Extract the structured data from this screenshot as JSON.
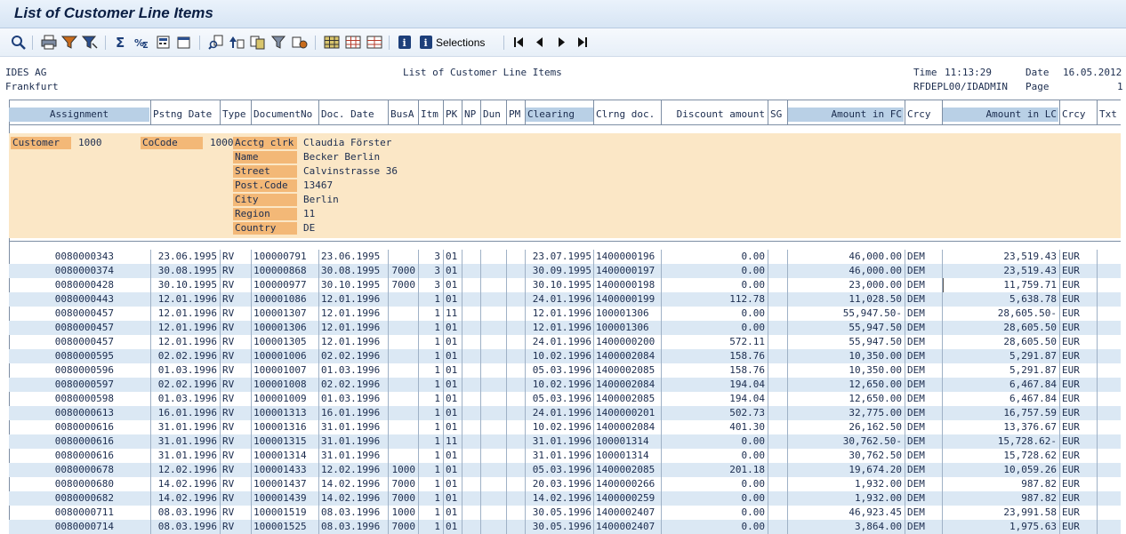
{
  "window": {
    "title": "List of Customer Line Items"
  },
  "toolbar": {
    "buttons": [
      "details-icon",
      "print-icon",
      "filter-icon",
      "filter-set-icon",
      "sum-icon",
      "subtotal-icon",
      "calculator-icon",
      "export-icon",
      "find-icon",
      "sort-ascending-icon",
      "sort-descending-icon",
      "layout-icon",
      "layout-save-icon",
      "grid-icon",
      "grid-change-icon",
      "grid-choose-icon",
      "info-icon",
      "selections-icon",
      "first-page-icon",
      "previous-page-icon",
      "next-page-icon",
      "last-page-icon"
    ],
    "selections_label": "Selections"
  },
  "report_header": {
    "company": "IDES AG",
    "city": "Frankfurt",
    "center_title": "List of Customer Line Items",
    "time_label": "Time",
    "time_value": "11:13:29",
    "date_label": "Date",
    "date_value": "16.05.2012",
    "program": "RFDEPL00/IDADMIN",
    "page_label": "Page",
    "page_value": "1"
  },
  "columns": [
    "Assignment",
    "Pstng Date",
    "Type",
    "DocumentNo",
    "Doc. Date",
    "BusA",
    "Itm",
    "PK",
    "NP",
    "Dun",
    "PM",
    "Clearing",
    "Clrng doc.",
    "Discount amount",
    "SG",
    "Amount in FC",
    "Crcy",
    "Amount in LC",
    "Crcy",
    "Txt"
  ],
  "customer": {
    "customer_label": "Customer",
    "customer_value": "1000",
    "cocode_label": "CoCode",
    "cocode_value": "1000",
    "fields": [
      {
        "label": "Acctg clrk",
        "value": "Claudia Förster"
      },
      {
        "label": "Name",
        "value": "Becker Berlin"
      },
      {
        "label": "Street",
        "value": "Calvinstrasse 36"
      },
      {
        "label": "Post.Code",
        "value": "13467"
      },
      {
        "label": "City",
        "value": "Berlin"
      },
      {
        "label": "Region",
        "value": "11"
      },
      {
        "label": "Country",
        "value": "DE"
      }
    ]
  },
  "rows": [
    {
      "assign": "0080000343",
      "pdate": "23.06.1995",
      "type": "RV",
      "doc": "100000791",
      "ddate": "23.06.1995",
      "busa": "",
      "itm": "3",
      "pk": "01",
      "clearing": "23.07.1995",
      "clrdoc": "1400000196",
      "disc": "0.00",
      "fc": "46,000.00",
      "fcc": "DEM",
      "lc": "23,519.43",
      "lcc": "EUR"
    },
    {
      "assign": "0080000374",
      "pdate": "30.08.1995",
      "type": "RV",
      "doc": "100000868",
      "ddate": "30.08.1995",
      "busa": "7000",
      "itm": "3",
      "pk": "01",
      "clearing": "30.09.1995",
      "clrdoc": "1400000197",
      "disc": "0.00",
      "fc": "46,000.00",
      "fcc": "DEM",
      "lc": "23,519.43",
      "lcc": "EUR"
    },
    {
      "assign": "0080000428",
      "pdate": "30.10.1995",
      "type": "RV",
      "doc": "100000977",
      "ddate": "30.10.1995",
      "busa": "7000",
      "itm": "3",
      "pk": "01",
      "clearing": "30.10.1995",
      "clrdoc": "1400000198",
      "disc": "0.00",
      "fc": "23,000.00",
      "fcc": "DEM",
      "lc": "11,759.71",
      "lcc": "EUR"
    },
    {
      "assign": "0080000443",
      "pdate": "12.01.1996",
      "type": "RV",
      "doc": "100001086",
      "ddate": "12.01.1996",
      "busa": "",
      "itm": "1",
      "pk": "01",
      "clearing": "24.01.1996",
      "clrdoc": "1400000199",
      "disc": "112.78",
      "fc": "11,028.50",
      "fcc": "DEM",
      "lc": "5,638.78",
      "lcc": "EUR"
    },
    {
      "assign": "0080000457",
      "pdate": "12.01.1996",
      "type": "RV",
      "doc": "100001307",
      "ddate": "12.01.1996",
      "busa": "",
      "itm": "1",
      "pk": "11",
      "clearing": "12.01.1996",
      "clrdoc": "100001306",
      "disc": "0.00",
      "fc": "55,947.50-",
      "fcc": "DEM",
      "lc": "28,605.50-",
      "lcc": "EUR"
    },
    {
      "assign": "0080000457",
      "pdate": "12.01.1996",
      "type": "RV",
      "doc": "100001306",
      "ddate": "12.01.1996",
      "busa": "",
      "itm": "1",
      "pk": "01",
      "clearing": "12.01.1996",
      "clrdoc": "100001306",
      "disc": "0.00",
      "fc": "55,947.50",
      "fcc": "DEM",
      "lc": "28,605.50",
      "lcc": "EUR"
    },
    {
      "assign": "0080000457",
      "pdate": "12.01.1996",
      "type": "RV",
      "doc": "100001305",
      "ddate": "12.01.1996",
      "busa": "",
      "itm": "1",
      "pk": "01",
      "clearing": "24.01.1996",
      "clrdoc": "1400000200",
      "disc": "572.11",
      "fc": "55,947.50",
      "fcc": "DEM",
      "lc": "28,605.50",
      "lcc": "EUR"
    },
    {
      "assign": "0080000595",
      "pdate": "02.02.1996",
      "type": "RV",
      "doc": "100001006",
      "ddate": "02.02.1996",
      "busa": "",
      "itm": "1",
      "pk": "01",
      "clearing": "10.02.1996",
      "clrdoc": "1400002084",
      "disc": "158.76",
      "fc": "10,350.00",
      "fcc": "DEM",
      "lc": "5,291.87",
      "lcc": "EUR"
    },
    {
      "assign": "0080000596",
      "pdate": "01.03.1996",
      "type": "RV",
      "doc": "100001007",
      "ddate": "01.03.1996",
      "busa": "",
      "itm": "1",
      "pk": "01",
      "clearing": "05.03.1996",
      "clrdoc": "1400002085",
      "disc": "158.76",
      "fc": "10,350.00",
      "fcc": "DEM",
      "lc": "5,291.87",
      "lcc": "EUR"
    },
    {
      "assign": "0080000597",
      "pdate": "02.02.1996",
      "type": "RV",
      "doc": "100001008",
      "ddate": "02.02.1996",
      "busa": "",
      "itm": "1",
      "pk": "01",
      "clearing": "10.02.1996",
      "clrdoc": "1400002084",
      "disc": "194.04",
      "fc": "12,650.00",
      "fcc": "DEM",
      "lc": "6,467.84",
      "lcc": "EUR"
    },
    {
      "assign": "0080000598",
      "pdate": "01.03.1996",
      "type": "RV",
      "doc": "100001009",
      "ddate": "01.03.1996",
      "busa": "",
      "itm": "1",
      "pk": "01",
      "clearing": "05.03.1996",
      "clrdoc": "1400002085",
      "disc": "194.04",
      "fc": "12,650.00",
      "fcc": "DEM",
      "lc": "6,467.84",
      "lcc": "EUR"
    },
    {
      "assign": "0080000613",
      "pdate": "16.01.1996",
      "type": "RV",
      "doc": "100001313",
      "ddate": "16.01.1996",
      "busa": "",
      "itm": "1",
      "pk": "01",
      "clearing": "24.01.1996",
      "clrdoc": "1400000201",
      "disc": "502.73",
      "fc": "32,775.00",
      "fcc": "DEM",
      "lc": "16,757.59",
      "lcc": "EUR"
    },
    {
      "assign": "0080000616",
      "pdate": "31.01.1996",
      "type": "RV",
      "doc": "100001316",
      "ddate": "31.01.1996",
      "busa": "",
      "itm": "1",
      "pk": "01",
      "clearing": "10.02.1996",
      "clrdoc": "1400002084",
      "disc": "401.30",
      "fc": "26,162.50",
      "fcc": "DEM",
      "lc": "13,376.67",
      "lcc": "EUR"
    },
    {
      "assign": "0080000616",
      "pdate": "31.01.1996",
      "type": "RV",
      "doc": "100001315",
      "ddate": "31.01.1996",
      "busa": "",
      "itm": "1",
      "pk": "11",
      "clearing": "31.01.1996",
      "clrdoc": "100001314",
      "disc": "0.00",
      "fc": "30,762.50-",
      "fcc": "DEM",
      "lc": "15,728.62-",
      "lcc": "EUR"
    },
    {
      "assign": "0080000616",
      "pdate": "31.01.1996",
      "type": "RV",
      "doc": "100001314",
      "ddate": "31.01.1996",
      "busa": "",
      "itm": "1",
      "pk": "01",
      "clearing": "31.01.1996",
      "clrdoc": "100001314",
      "disc": "0.00",
      "fc": "30,762.50",
      "fcc": "DEM",
      "lc": "15,728.62",
      "lcc": "EUR"
    },
    {
      "assign": "0080000678",
      "pdate": "12.02.1996",
      "type": "RV",
      "doc": "100001433",
      "ddate": "12.02.1996",
      "busa": "1000",
      "itm": "1",
      "pk": "01",
      "clearing": "05.03.1996",
      "clrdoc": "1400002085",
      "disc": "201.18",
      "fc": "19,674.20",
      "fcc": "DEM",
      "lc": "10,059.26",
      "lcc": "EUR"
    },
    {
      "assign": "0080000680",
      "pdate": "14.02.1996",
      "type": "RV",
      "doc": "100001437",
      "ddate": "14.02.1996",
      "busa": "7000",
      "itm": "1",
      "pk": "01",
      "clearing": "20.03.1996",
      "clrdoc": "1400000266",
      "disc": "0.00",
      "fc": "1,932.00",
      "fcc": "DEM",
      "lc": "987.82",
      "lcc": "EUR"
    },
    {
      "assign": "0080000682",
      "pdate": "14.02.1996",
      "type": "RV",
      "doc": "100001439",
      "ddate": "14.02.1996",
      "busa": "7000",
      "itm": "1",
      "pk": "01",
      "clearing": "14.02.1996",
      "clrdoc": "1400000259",
      "disc": "0.00",
      "fc": "1,932.00",
      "fcc": "DEM",
      "lc": "987.82",
      "lcc": "EUR"
    },
    {
      "assign": "0080000711",
      "pdate": "08.03.1996",
      "type": "RV",
      "doc": "100001519",
      "ddate": "08.03.1996",
      "busa": "1000",
      "itm": "1",
      "pk": "01",
      "clearing": "30.05.1996",
      "clrdoc": "1400002407",
      "disc": "0.00",
      "fc": "46,923.45",
      "fcc": "DEM",
      "lc": "23,991.58",
      "lcc": "EUR"
    },
    {
      "assign": "0080000714",
      "pdate": "08.03.1996",
      "type": "RV",
      "doc": "100001525",
      "ddate": "08.03.1996",
      "busa": "7000",
      "itm": "1",
      "pk": "01",
      "clearing": "30.05.1996",
      "clrdoc": "1400002407",
      "disc": "0.00",
      "fc": "3,864.00",
      "fcc": "DEM",
      "lc": "1,975.63",
      "lcc": "EUR"
    }
  ]
}
